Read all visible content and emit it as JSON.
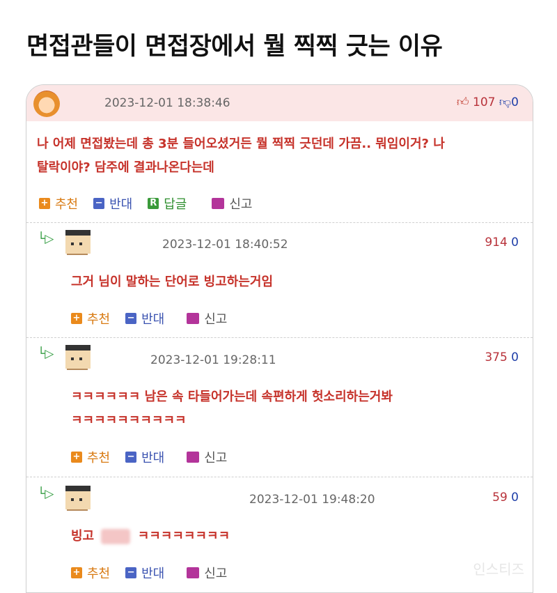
{
  "headline": "면접관들이 면접장에서 뭘 찍찍 긋는 이유",
  "post": {
    "timestamp": "2023-12-01 18:38:46",
    "up_count": "107",
    "down_count": "0",
    "text_line1": "나 어제 면접봤는데 총 3분 들어오셨거든 뭘 찍찍 긋던데 가끔.. 뭐임이거? 나",
    "text_line2": "탈락이야? 담주에 결과나온다는데",
    "actions": {
      "recommend": "추천",
      "oppose": "반대",
      "reply": "답글",
      "report": "신고"
    },
    "icons": {
      "plus": "+",
      "minus": "−",
      "reply": "R"
    }
  },
  "replies": [
    {
      "timestamp": "2023-12-01 18:40:52",
      "up": "914",
      "down": "0",
      "text_line1": "그거 님이 말하는 단어로 빙고하는거임",
      "text_line2": ""
    },
    {
      "timestamp": "2023-12-01 19:28:11",
      "up": "375",
      "down": "0",
      "text_line1": "ㅋㅋㅋㅋㅋㅋ 남은 속 타들어가는데 속편하게 헛소리하는거봐",
      "text_line2": "ㅋㅋㅋㅋㅋㅋㅋㅋㅋㅋ"
    },
    {
      "timestamp": "2023-12-01 19:48:20",
      "up": "59",
      "down": "0",
      "text_prefix": "빙고",
      "text_suffix": "ㅋㅋㅋㅋㅋㅋㅋㅋ"
    }
  ],
  "reply_actions": {
    "recommend": "추천",
    "oppose": "반대",
    "report": "신고"
  },
  "reply_arrow": "└▷",
  "watermark": "인스티즈",
  "colors": {
    "comment_text": "#c6322a",
    "header_bg": "#fbe6e6",
    "up": "#b8323a",
    "down": "#1f3fa8"
  }
}
